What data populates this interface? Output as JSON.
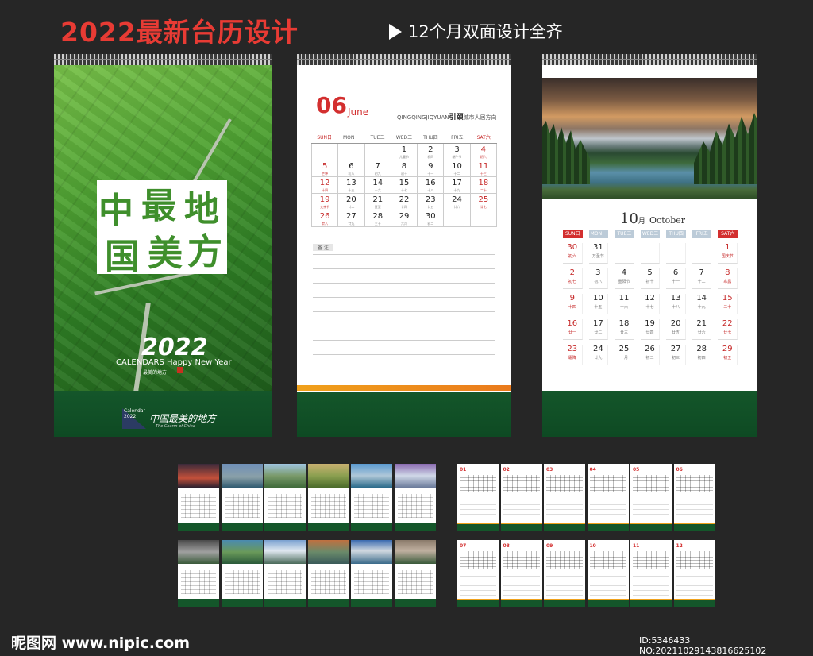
{
  "header": {
    "title": "2022最新台历设计",
    "subtitle": "12个月双面设计全齐"
  },
  "cover": {
    "calligraphy": [
      "中",
      "最",
      "地",
      "国",
      "美",
      "方"
    ],
    "year": "2022",
    "line": "CALENDARS Happy New Year",
    "small": "最美的地方",
    "base_text1": "Calendar",
    "base_text2": "2022",
    "base_sign": "中国最美的地方",
    "base_sign2": "The Charm of China"
  },
  "june": {
    "month_num": "06",
    "month_word": "June",
    "brand": "QINGQINGJIQYUAN",
    "brand_cn": "引頤",
    "brand_tail": "城市人居方向",
    "weekdays": [
      "SUN日",
      "MON一",
      "TUE二",
      "WED三",
      "THU四",
      "FRI五",
      "SAT六"
    ],
    "weeks": [
      [
        {
          "d": "",
          "l": ""
        },
        {
          "d": "",
          "l": ""
        },
        {
          "d": "",
          "l": ""
        },
        {
          "d": "1",
          "l": "儿童节"
        },
        {
          "d": "2",
          "l": "初四"
        },
        {
          "d": "3",
          "l": "端午节"
        },
        {
          "d": "4",
          "l": "初六"
        }
      ],
      [
        {
          "d": "5",
          "l": "芒种"
        },
        {
          "d": "6",
          "l": "初八"
        },
        {
          "d": "7",
          "l": "初九"
        },
        {
          "d": "8",
          "l": "初十"
        },
        {
          "d": "9",
          "l": "十一"
        },
        {
          "d": "10",
          "l": "十二"
        },
        {
          "d": "11",
          "l": "十三"
        }
      ],
      [
        {
          "d": "12",
          "l": "十四"
        },
        {
          "d": "13",
          "l": "十五"
        },
        {
          "d": "14",
          "l": "十六"
        },
        {
          "d": "15",
          "l": "十七"
        },
        {
          "d": "16",
          "l": "十八"
        },
        {
          "d": "17",
          "l": "十九"
        },
        {
          "d": "18",
          "l": "二十"
        }
      ],
      [
        {
          "d": "19",
          "l": "父亲节"
        },
        {
          "d": "20",
          "l": "廿二"
        },
        {
          "d": "21",
          "l": "夏至"
        },
        {
          "d": "22",
          "l": "廿四"
        },
        {
          "d": "23",
          "l": "廿五"
        },
        {
          "d": "24",
          "l": "廿六"
        },
        {
          "d": "25",
          "l": "廿七"
        }
      ],
      [
        {
          "d": "26",
          "l": "廿八"
        },
        {
          "d": "27",
          "l": "廿九"
        },
        {
          "d": "28",
          "l": "三十"
        },
        {
          "d": "29",
          "l": "六月"
        },
        {
          "d": "30",
          "l": "初二"
        },
        {
          "d": "",
          "l": ""
        },
        {
          "d": "",
          "l": ""
        }
      ]
    ],
    "note_label": "备 注"
  },
  "october": {
    "month_num": "10",
    "month_cn": "月",
    "month_word": "October",
    "weekdays": [
      "SUN日",
      "MON一",
      "TUE二",
      "WED三",
      "THU四",
      "FRI五",
      "SAT六"
    ],
    "weeks": [
      [
        {
          "d": "30",
          "l": "初六"
        },
        {
          "d": "31",
          "l": "万圣节"
        },
        {
          "d": "",
          "l": ""
        },
        {
          "d": "",
          "l": ""
        },
        {
          "d": "",
          "l": ""
        },
        {
          "d": "",
          "l": ""
        },
        {
          "d": "1",
          "l": "国庆节"
        }
      ],
      [
        {
          "d": "2",
          "l": "初七"
        },
        {
          "d": "3",
          "l": "初八"
        },
        {
          "d": "4",
          "l": "重阳节"
        },
        {
          "d": "5",
          "l": "初十"
        },
        {
          "d": "6",
          "l": "十一"
        },
        {
          "d": "7",
          "l": "十二"
        },
        {
          "d": "8",
          "l": "寒露"
        }
      ],
      [
        {
          "d": "9",
          "l": "十四"
        },
        {
          "d": "10",
          "l": "十五"
        },
        {
          "d": "11",
          "l": "十六"
        },
        {
          "d": "12",
          "l": "十七"
        },
        {
          "d": "13",
          "l": "十八"
        },
        {
          "d": "14",
          "l": "十九"
        },
        {
          "d": "15",
          "l": "二十"
        }
      ],
      [
        {
          "d": "16",
          "l": "廿一"
        },
        {
          "d": "17",
          "l": "廿二"
        },
        {
          "d": "18",
          "l": "廿三"
        },
        {
          "d": "19",
          "l": "廿四"
        },
        {
          "d": "20",
          "l": "廿五"
        },
        {
          "d": "21",
          "l": "廿六"
        },
        {
          "d": "22",
          "l": "廿七"
        }
      ],
      [
        {
          "d": "23",
          "l": "霜降"
        },
        {
          "d": "24",
          "l": "廿九"
        },
        {
          "d": "25",
          "l": "十月"
        },
        {
          "d": "26",
          "l": "初二"
        },
        {
          "d": "27",
          "l": "初三"
        },
        {
          "d": "28",
          "l": "初四"
        },
        {
          "d": "29",
          "l": "初五"
        }
      ]
    ]
  },
  "grid_months": [
    "01",
    "02",
    "03",
    "04",
    "05",
    "06",
    "07",
    "08",
    "09",
    "10",
    "11",
    "12"
  ],
  "watermark": {
    "left": "昵图网 www.nipic.com",
    "right": "ID:5346433 NO:20211029143816625102"
  }
}
